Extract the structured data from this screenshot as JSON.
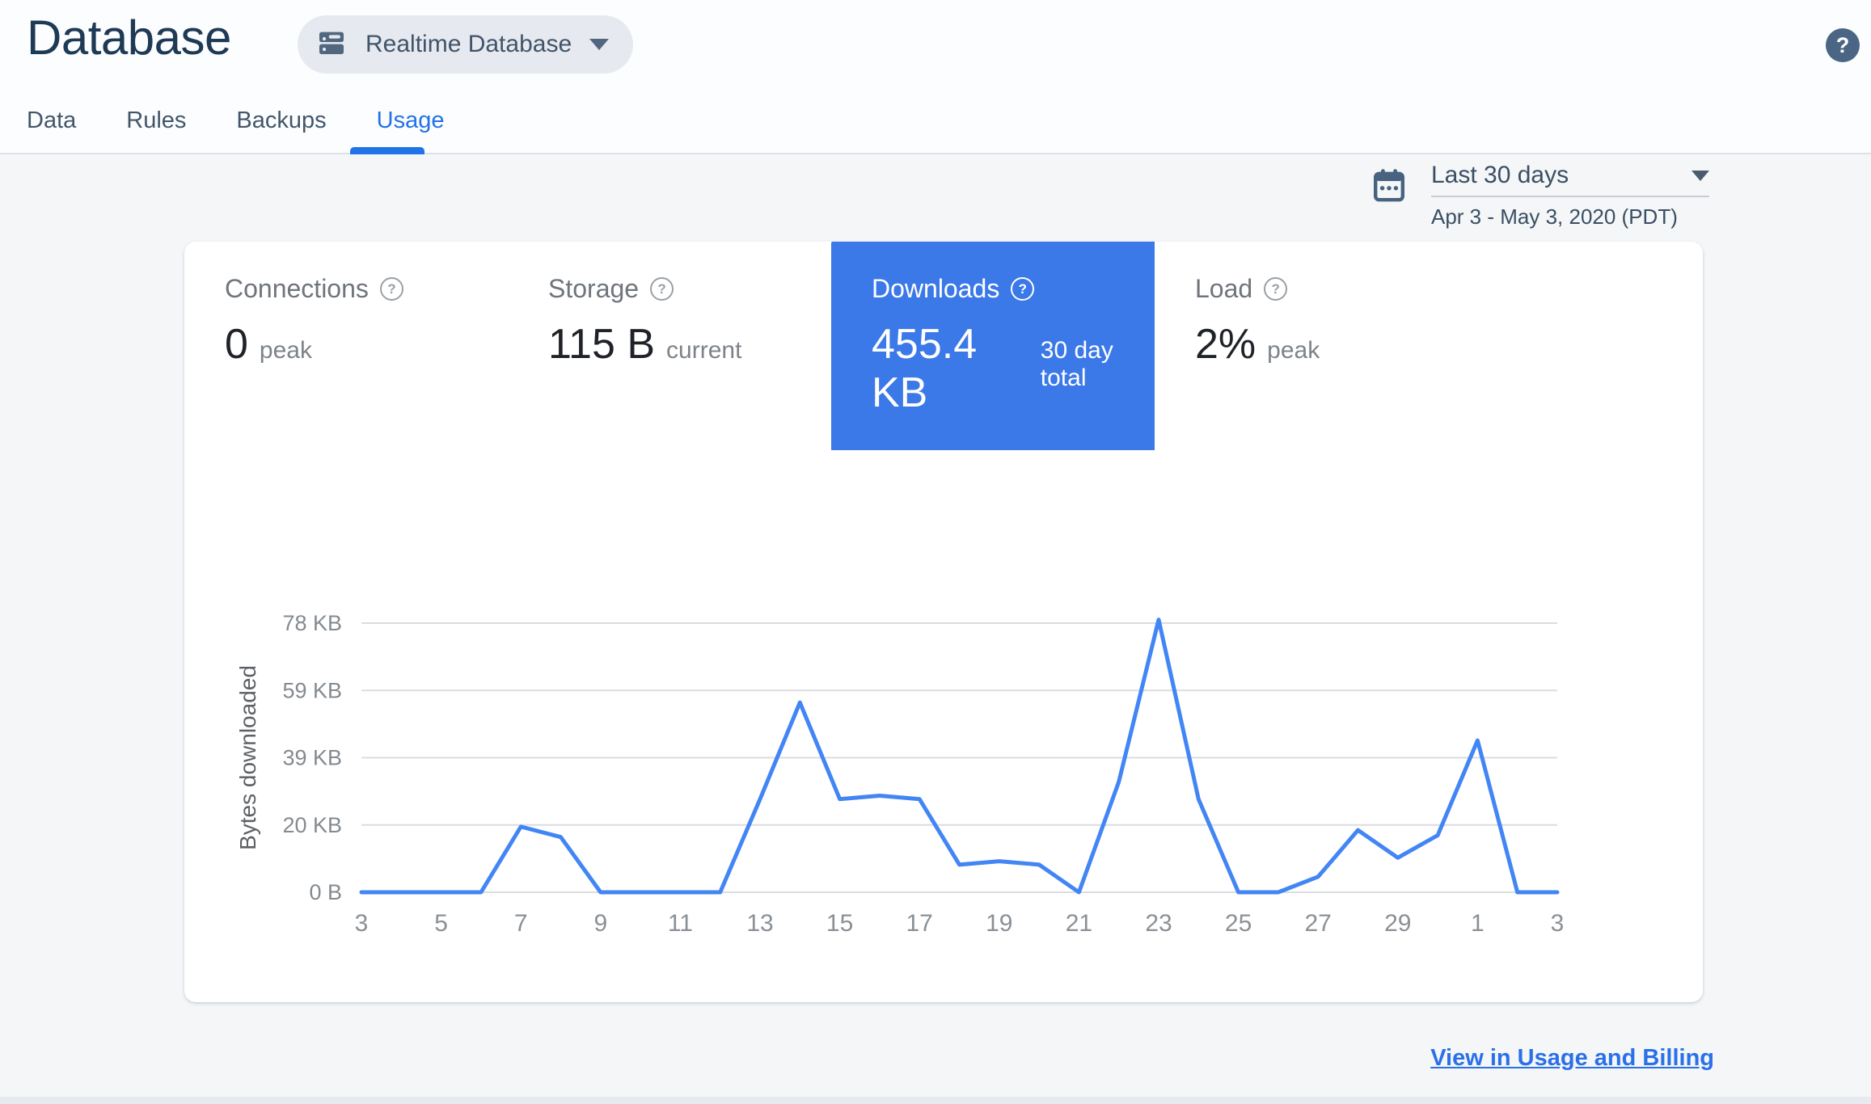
{
  "header": {
    "title": "Database",
    "database_selector": {
      "label": "Realtime Database"
    },
    "help_button": "?"
  },
  "tabs": [
    {
      "label": "Data",
      "active": false
    },
    {
      "label": "Rules",
      "active": false
    },
    {
      "label": "Backups",
      "active": false
    },
    {
      "label": "Usage",
      "active": true
    }
  ],
  "date_selector": {
    "preset": "Last 30 days",
    "range": "Apr 3 - May 3, 2020 (PDT)"
  },
  "metrics": [
    {
      "label": "Connections",
      "value": "0",
      "unit": "peak",
      "selected": false
    },
    {
      "label": "Storage",
      "value": "115 B",
      "unit": "current",
      "selected": false
    },
    {
      "label": "Downloads",
      "value": "455.4 KB",
      "unit": "30 day total",
      "selected": true
    },
    {
      "label": "Load",
      "value": "2%",
      "unit": "peak",
      "selected": false
    }
  ],
  "icons": {
    "help_glyph": "?"
  },
  "footer": {
    "link_label": "View in Usage and Billing"
  },
  "colors": {
    "accent": "#3b78e8",
    "line_blue": "#4285f4",
    "link_blue": "#2a70e8",
    "tab_active": "#2272e8",
    "title_color": "#1e3a55"
  },
  "chart_data": {
    "type": "line",
    "title": "Downloads (bytes downloaded per day)",
    "xlabel": "",
    "ylabel": "Bytes downloaded",
    "categories": [
      "3",
      "4",
      "5",
      "6",
      "7",
      "8",
      "9",
      "10",
      "11",
      "12",
      "13",
      "14",
      "15",
      "16",
      "17",
      "18",
      "19",
      "20",
      "21",
      "22",
      "23",
      "24",
      "25",
      "26",
      "27",
      "28",
      "29",
      "30",
      "1",
      "2",
      "3"
    ],
    "values_kb": [
      0,
      0,
      0,
      0,
      19,
      16,
      0,
      0,
      0,
      0,
      27,
      55,
      27,
      28,
      27,
      8,
      9,
      8,
      0,
      32,
      79,
      27,
      0,
      0,
      4.5,
      18,
      10,
      16.5,
      44,
      0,
      0
    ],
    "x_tick_labels_shown": [
      "3",
      "5",
      "7",
      "9",
      "11",
      "13",
      "15",
      "17",
      "19",
      "21",
      "23",
      "25",
      "27",
      "29",
      "1",
      "3"
    ],
    "y_ticks": [
      {
        "kb": 0,
        "label": "0 B"
      },
      {
        "kb": 19.5,
        "label": "20 KB"
      },
      {
        "kb": 39,
        "label": "39 KB"
      },
      {
        "kb": 58.5,
        "label": "59 KB"
      },
      {
        "kb": 78,
        "label": "78 KB"
      }
    ],
    "ylim": [
      0,
      80
    ],
    "grid": true,
    "legend": "none",
    "line_color": "#4285f4",
    "period_total": "455.4 KB"
  }
}
